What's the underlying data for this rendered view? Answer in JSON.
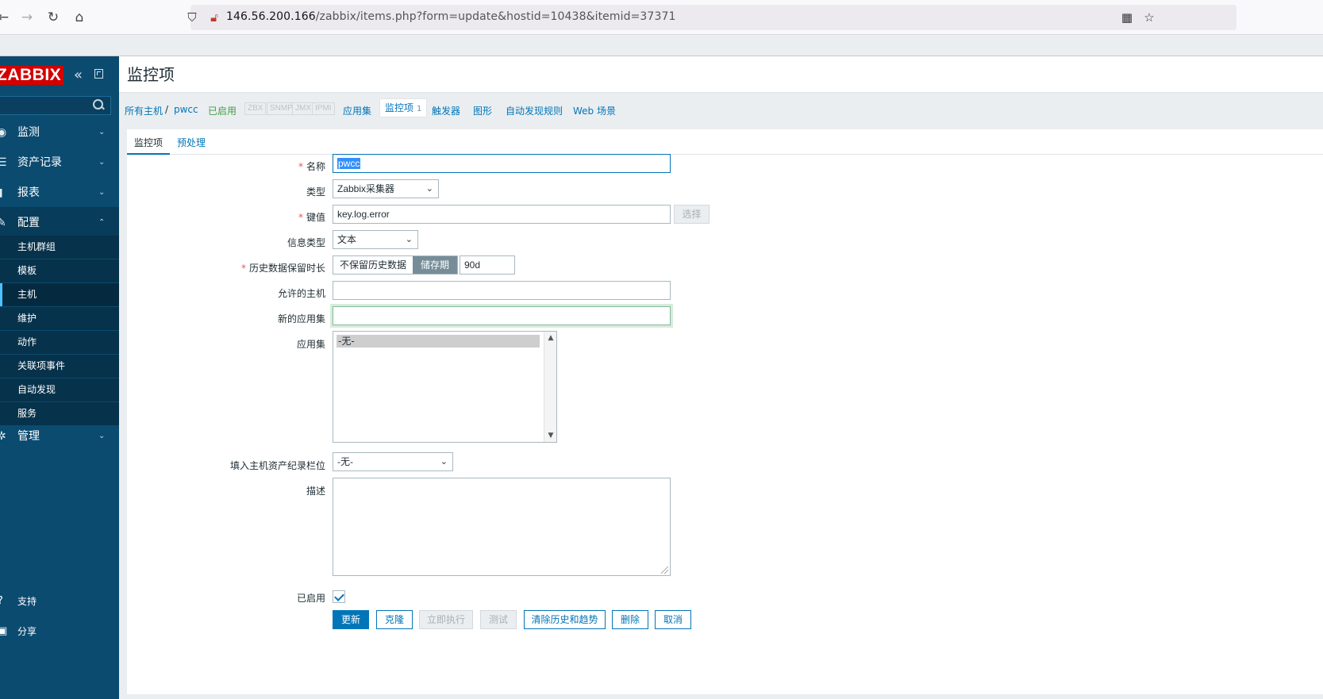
{
  "browser": {
    "url_host": "146.56.200.166",
    "url_path": "/zabbix/items.php?form=update&hostid=10438&itemid=37371"
  },
  "sidebar": {
    "logo": "ZABBIX",
    "menu": [
      {
        "label": "监测",
        "icon": "eye-icon"
      },
      {
        "label": "资产记录",
        "icon": "list-icon"
      },
      {
        "label": "报表",
        "icon": "report-icon"
      },
      {
        "label": "配置",
        "icon": "wrench-icon"
      },
      {
        "label": "管理",
        "icon": "gear-icon"
      }
    ],
    "submenu": [
      "主机群组",
      "模板",
      "主机",
      "维护",
      "动作",
      "关联项事件",
      "自动发现",
      "服务"
    ],
    "bottom": [
      "支持",
      "分享"
    ]
  },
  "page": {
    "title": "监控项"
  },
  "host_nav": {
    "all_hosts": "所有主机",
    "separator": "/",
    "host": "pwcc",
    "status": "已启用",
    "availability": [
      "ZBX",
      "SNMP",
      "JMX",
      "IPMI"
    ],
    "applications": "应用集",
    "items": "监控项",
    "items_count": "1",
    "triggers": "触发器",
    "graphs": "图形",
    "discovery": "自动发现规则",
    "web": "Web 场景"
  },
  "tabs": [
    "监控项",
    "预处理"
  ],
  "form": {
    "name_label": "名称",
    "name_value": "pwcc",
    "type_label": "类型",
    "type_value": "Zabbix采集器",
    "key_label": "键值",
    "key_value": "key.log.error",
    "key_select_btn": "选择",
    "info_type_label": "信息类型",
    "info_type_value": "文本",
    "history_label": "历史数据保留时长",
    "history_opt_no": "不保留历史数据",
    "history_opt_store": "储存期",
    "history_value": "90d",
    "allowed_hosts_label": "允许的主机",
    "allowed_hosts_value": "",
    "new_app_label": "新的应用集",
    "new_app_value": "",
    "apps_label": "应用集",
    "apps_option": "-无-",
    "inventory_label": "填入主机资产纪录栏位",
    "inventory_value": "-无-",
    "description_label": "描述",
    "enabled_label": "已启用",
    "enabled": true
  },
  "buttons": {
    "update": "更新",
    "clone": "克隆",
    "execute_now": "立即执行",
    "test": "测试",
    "clear_history": "清除历史和趋势",
    "delete": "删除",
    "cancel": "取消"
  }
}
